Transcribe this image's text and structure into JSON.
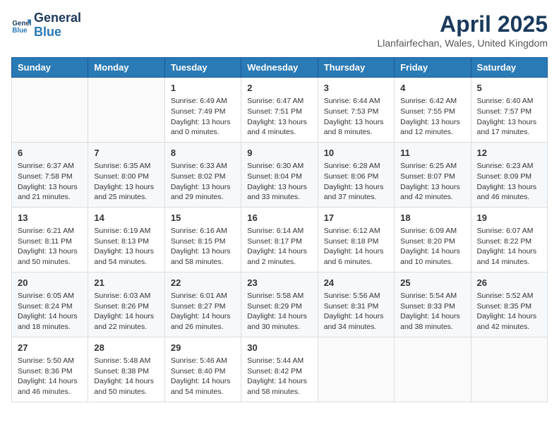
{
  "header": {
    "logo_line1": "General",
    "logo_line2": "Blue",
    "month_title": "April 2025",
    "location": "Llanfairfechan, Wales, United Kingdom"
  },
  "weekdays": [
    "Sunday",
    "Monday",
    "Tuesday",
    "Wednesday",
    "Thursday",
    "Friday",
    "Saturday"
  ],
  "weeks": [
    [
      {
        "day": "",
        "info": ""
      },
      {
        "day": "",
        "info": ""
      },
      {
        "day": "1",
        "info": "Sunrise: 6:49 AM\nSunset: 7:49 PM\nDaylight: 13 hours and 0 minutes."
      },
      {
        "day": "2",
        "info": "Sunrise: 6:47 AM\nSunset: 7:51 PM\nDaylight: 13 hours and 4 minutes."
      },
      {
        "day": "3",
        "info": "Sunrise: 6:44 AM\nSunset: 7:53 PM\nDaylight: 13 hours and 8 minutes."
      },
      {
        "day": "4",
        "info": "Sunrise: 6:42 AM\nSunset: 7:55 PM\nDaylight: 13 hours and 12 minutes."
      },
      {
        "day": "5",
        "info": "Sunrise: 6:40 AM\nSunset: 7:57 PM\nDaylight: 13 hours and 17 minutes."
      }
    ],
    [
      {
        "day": "6",
        "info": "Sunrise: 6:37 AM\nSunset: 7:58 PM\nDaylight: 13 hours and 21 minutes."
      },
      {
        "day": "7",
        "info": "Sunrise: 6:35 AM\nSunset: 8:00 PM\nDaylight: 13 hours and 25 minutes."
      },
      {
        "day": "8",
        "info": "Sunrise: 6:33 AM\nSunset: 8:02 PM\nDaylight: 13 hours and 29 minutes."
      },
      {
        "day": "9",
        "info": "Sunrise: 6:30 AM\nSunset: 8:04 PM\nDaylight: 13 hours and 33 minutes."
      },
      {
        "day": "10",
        "info": "Sunrise: 6:28 AM\nSunset: 8:06 PM\nDaylight: 13 hours and 37 minutes."
      },
      {
        "day": "11",
        "info": "Sunrise: 6:25 AM\nSunset: 8:07 PM\nDaylight: 13 hours and 42 minutes."
      },
      {
        "day": "12",
        "info": "Sunrise: 6:23 AM\nSunset: 8:09 PM\nDaylight: 13 hours and 46 minutes."
      }
    ],
    [
      {
        "day": "13",
        "info": "Sunrise: 6:21 AM\nSunset: 8:11 PM\nDaylight: 13 hours and 50 minutes."
      },
      {
        "day": "14",
        "info": "Sunrise: 6:19 AM\nSunset: 8:13 PM\nDaylight: 13 hours and 54 minutes."
      },
      {
        "day": "15",
        "info": "Sunrise: 6:16 AM\nSunset: 8:15 PM\nDaylight: 13 hours and 58 minutes."
      },
      {
        "day": "16",
        "info": "Sunrise: 6:14 AM\nSunset: 8:17 PM\nDaylight: 14 hours and 2 minutes."
      },
      {
        "day": "17",
        "info": "Sunrise: 6:12 AM\nSunset: 8:18 PM\nDaylight: 14 hours and 6 minutes."
      },
      {
        "day": "18",
        "info": "Sunrise: 6:09 AM\nSunset: 8:20 PM\nDaylight: 14 hours and 10 minutes."
      },
      {
        "day": "19",
        "info": "Sunrise: 6:07 AM\nSunset: 8:22 PM\nDaylight: 14 hours and 14 minutes."
      }
    ],
    [
      {
        "day": "20",
        "info": "Sunrise: 6:05 AM\nSunset: 8:24 PM\nDaylight: 14 hours and 18 minutes."
      },
      {
        "day": "21",
        "info": "Sunrise: 6:03 AM\nSunset: 8:26 PM\nDaylight: 14 hours and 22 minutes."
      },
      {
        "day": "22",
        "info": "Sunrise: 6:01 AM\nSunset: 8:27 PM\nDaylight: 14 hours and 26 minutes."
      },
      {
        "day": "23",
        "info": "Sunrise: 5:58 AM\nSunset: 8:29 PM\nDaylight: 14 hours and 30 minutes."
      },
      {
        "day": "24",
        "info": "Sunrise: 5:56 AM\nSunset: 8:31 PM\nDaylight: 14 hours and 34 minutes."
      },
      {
        "day": "25",
        "info": "Sunrise: 5:54 AM\nSunset: 8:33 PM\nDaylight: 14 hours and 38 minutes."
      },
      {
        "day": "26",
        "info": "Sunrise: 5:52 AM\nSunset: 8:35 PM\nDaylight: 14 hours and 42 minutes."
      }
    ],
    [
      {
        "day": "27",
        "info": "Sunrise: 5:50 AM\nSunset: 8:36 PM\nDaylight: 14 hours and 46 minutes."
      },
      {
        "day": "28",
        "info": "Sunrise: 5:48 AM\nSunset: 8:38 PM\nDaylight: 14 hours and 50 minutes."
      },
      {
        "day": "29",
        "info": "Sunrise: 5:46 AM\nSunset: 8:40 PM\nDaylight: 14 hours and 54 minutes."
      },
      {
        "day": "30",
        "info": "Sunrise: 5:44 AM\nSunset: 8:42 PM\nDaylight: 14 hours and 58 minutes."
      },
      {
        "day": "",
        "info": ""
      },
      {
        "day": "",
        "info": ""
      },
      {
        "day": "",
        "info": ""
      }
    ]
  ]
}
